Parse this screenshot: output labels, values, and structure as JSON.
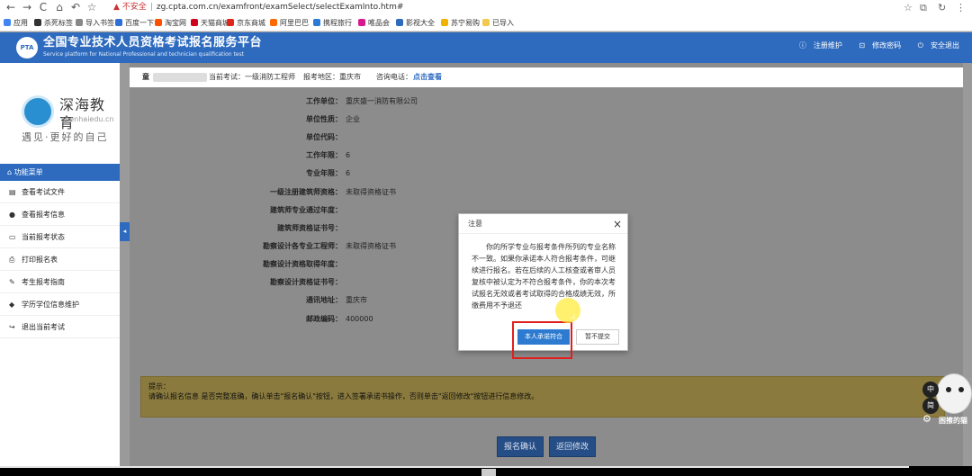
{
  "browser": {
    "nav": [
      "←",
      "→",
      "C",
      "⌂",
      "↶",
      "☆"
    ],
    "security": "不安全",
    "url": "zg.cpta.com.cn/examfront/examSelect/selectExamInto.htm#",
    "right_icons": [
      "☆",
      "⧉",
      "↻",
      "⋮"
    ],
    "bookmarks": [
      {
        "label": "应用",
        "color": "#4285f4"
      },
      {
        "label": "杀死标签",
        "color": "#333333"
      },
      {
        "label": "导入书签",
        "color": "#888888"
      },
      {
        "label": "百度一下",
        "color": "#2f6fd8"
      },
      {
        "label": "淘宝网",
        "color": "#ff5000"
      },
      {
        "label": "天猫商城",
        "color": "#d0021b"
      },
      {
        "label": "京东商城",
        "color": "#e1251b"
      },
      {
        "label": "阿里巴巴",
        "color": "#ff6a00"
      },
      {
        "label": "携程旅行",
        "color": "#2a7ad6"
      },
      {
        "label": "唯品会",
        "color": "#d8198e"
      },
      {
        "label": "影视大全",
        "color": "#2e6bbf"
      },
      {
        "label": "苏宁易购",
        "color": "#f0b400"
      },
      {
        "label": "已导入",
        "color": "#f2c94c"
      }
    ]
  },
  "site": {
    "logo": "PTA",
    "title": "全国专业技术人员资格考试报名服务平台",
    "subtitle": "Service platform for National Professional and technician qualification test",
    "links": [
      "注册维护",
      "修改密码",
      "安全退出"
    ]
  },
  "sidebar": {
    "brand_name": "深海教育",
    "brand_site": "shenhaiedu.cn",
    "brand_slogan": "遇见·更好的自己",
    "menu_header": "功能菜单",
    "items": [
      {
        "icon": "▤",
        "label": "查看考试文件"
      },
      {
        "icon": "●",
        "label": "查看报考信息"
      },
      {
        "icon": "▭",
        "label": "当前报考状态"
      },
      {
        "icon": "⎙",
        "label": "打印报名表"
      },
      {
        "icon": "✎",
        "label": "考生报考指南"
      },
      {
        "icon": "◆",
        "label": "学历学位信息维护"
      },
      {
        "icon": "↪",
        "label": "退出当前考试"
      }
    ],
    "toggle": "◂"
  },
  "userbar": {
    "user_initial": "童",
    "current_exam_label": "当前考试：",
    "current_exam": "一级消防工程师",
    "region_label": "报考地区：",
    "region": "重庆市",
    "phone_label": "咨询电话：",
    "phone_link": "点击查看"
  },
  "form": {
    "rows": [
      {
        "label": "工作单位：",
        "value": "重庆盛一消防有限公司"
      },
      {
        "label": "单位性质：",
        "value": "企业"
      },
      {
        "label": "单位代码：",
        "value": ""
      },
      {
        "label": "工作年限：",
        "value": "6"
      },
      {
        "label": "专业年限：",
        "value": "6"
      },
      {
        "label": "一级注册建筑师资格：",
        "value": "未取得资格证书"
      },
      {
        "label": "建筑师专业通过年度：",
        "value": ""
      },
      {
        "label": "建筑师资格证书号：",
        "value": ""
      },
      {
        "label": "勘察设计各专业工程师：",
        "value": "未取得资格证书"
      },
      {
        "label": "勘察设计资格取得年度：",
        "value": ""
      },
      {
        "label": "勘察设计资格证书号：",
        "value": ""
      },
      {
        "label": "通讯地址：",
        "value": "重庆市"
      },
      {
        "label": "邮政编码：",
        "value": "400000"
      }
    ]
  },
  "tip": {
    "title": "提示：",
    "text": "请确认报名信息 是否完整准确，确认单击\"报名确认\"按钮，进入签署承诺书操作，否则单击\"返回修改\"按钮进行信息修改。"
  },
  "actions": {
    "confirm": "报名确认",
    "back": "返回修改"
  },
  "modal": {
    "title": "注意",
    "close": "×",
    "body": "你的所学专业与报考条件所列的专业名称不一致。如果你承诺本人符合报考条件，可继续进行报名。若在后续的人工核查或者审人员复核中被认定为不符合报考条件，你的本次考试报名无效或者考试取得的合格成绩无效，所缴费用不予退还",
    "ok": "本人承诺符合",
    "cancel": "暂不提交",
    "cursor": "☝"
  },
  "widgets": {
    "lang_zh": "中",
    "lang_jian": "简",
    "gear": "⚙",
    "sticker_text": "困擦的猫"
  },
  "watermark": "大数暗镜",
  "colors": {
    "brand": "#2e6bbf",
    "highlight": "#e02020",
    "ok_button": "#2d7bd0"
  }
}
